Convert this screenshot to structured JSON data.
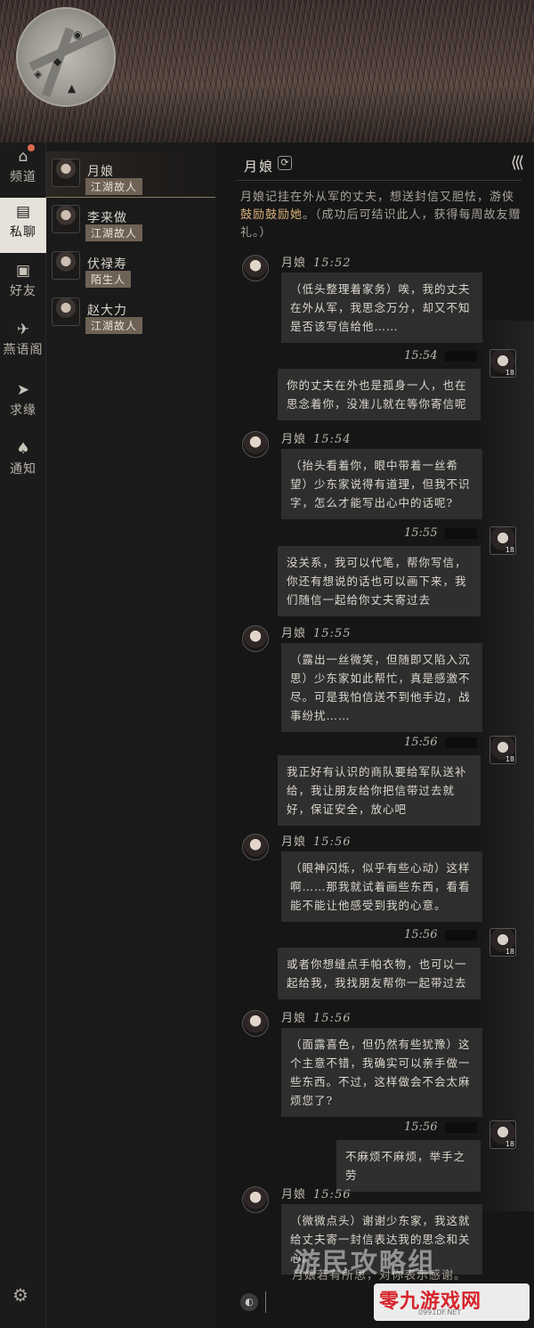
{
  "nav": {
    "items": [
      {
        "label": "频道",
        "icon": "home-icon"
      },
      {
        "label": "私聊",
        "icon": "chat-icon"
      },
      {
        "label": "好友",
        "icon": "friend-icon"
      },
      {
        "label": "燕语阁",
        "icon": "swallow-icon"
      },
      {
        "label": "求缘",
        "icon": "paper-plane-icon"
      },
      {
        "label": "通知",
        "icon": "bell-icon"
      }
    ],
    "active_index": 1
  },
  "contacts": [
    {
      "name": "月娘",
      "tag": "江湖故人"
    },
    {
      "name": "李来做",
      "tag": "江湖故人"
    },
    {
      "name": "伏禄寿",
      "tag": "陌生人"
    },
    {
      "name": "赵大力",
      "tag": "江湖故人"
    }
  ],
  "chat": {
    "title": "月娘",
    "intro_prefix": "月娘记挂在外从军的丈夫，想送封信又胆怯，游侠",
    "intro_highlight": "鼓励鼓励她",
    "intro_suffix": "。（成功后可结识此人，获得每周故友赠礼。）",
    "player_level": "18",
    "messages": [
      {
        "from": "npc",
        "name": "月娘",
        "time": "15:52",
        "text": "（低头整理着家务）唉，我的丈夫在外从军，我思念万分，却又不知是否该写信给他……"
      },
      {
        "from": "player",
        "time": "15:54",
        "text": "你的丈夫在外也是孤身一人，也在思念着你，没准儿就在等你寄信呢"
      },
      {
        "from": "npc",
        "name": "月娘",
        "time": "15:54",
        "text": "（抬头看着你，眼中带着一丝希望）少东家说得有道理，但我不识字，怎么才能写出心中的话呢?"
      },
      {
        "from": "player",
        "time": "15:55",
        "text": "没关系，我可以代笔，帮你写信，你还有想说的话也可以画下来，我们随信一起给你丈夫寄过去"
      },
      {
        "from": "npc",
        "name": "月娘",
        "time": "15:55",
        "text": "（露出一丝微笑，但随即又陷入沉思）少东家如此帮忙，真是感激不尽。可是我怕信送不到他手边，战事纷扰……"
      },
      {
        "from": "player",
        "time": "15:56",
        "text": "我正好有认识的商队要给军队送补给，我让朋友给你把信带过去就好，保证安全，放心吧"
      },
      {
        "from": "npc",
        "name": "月娘",
        "time": "15:56",
        "text": "（眼神闪烁，似乎有些心动）这样啊……那我就试着画些东西，看看能不能让他感受到我的心意。"
      },
      {
        "from": "player",
        "time": "15:56",
        "text": "或者你想缝点手帕衣物，也可以一起给我，我找朋友帮你一起带过去"
      },
      {
        "from": "npc",
        "name": "月娘",
        "time": "15:56",
        "text": "（面露喜色，但仍然有些犹豫）这个主意不错，我确实可以亲手做一些东西。不过，这样做会不会太麻烦您了?"
      },
      {
        "from": "player",
        "time": "15:56",
        "text": "不麻烦不麻烦，举手之劳"
      },
      {
        "from": "npc",
        "name": "月娘",
        "time": "15:56",
        "text": "（微微点头）谢谢少东家，我这就给丈夫寄一封信表达我的思念和关心。"
      }
    ],
    "footer_note": "月娘若有所思，对你表示感谢。",
    "input_placeholder": ""
  },
  "watermark": {
    "main": "游民攻略组",
    "logo_text": "零九游戏网",
    "logo_url": "0991DF.NET"
  }
}
